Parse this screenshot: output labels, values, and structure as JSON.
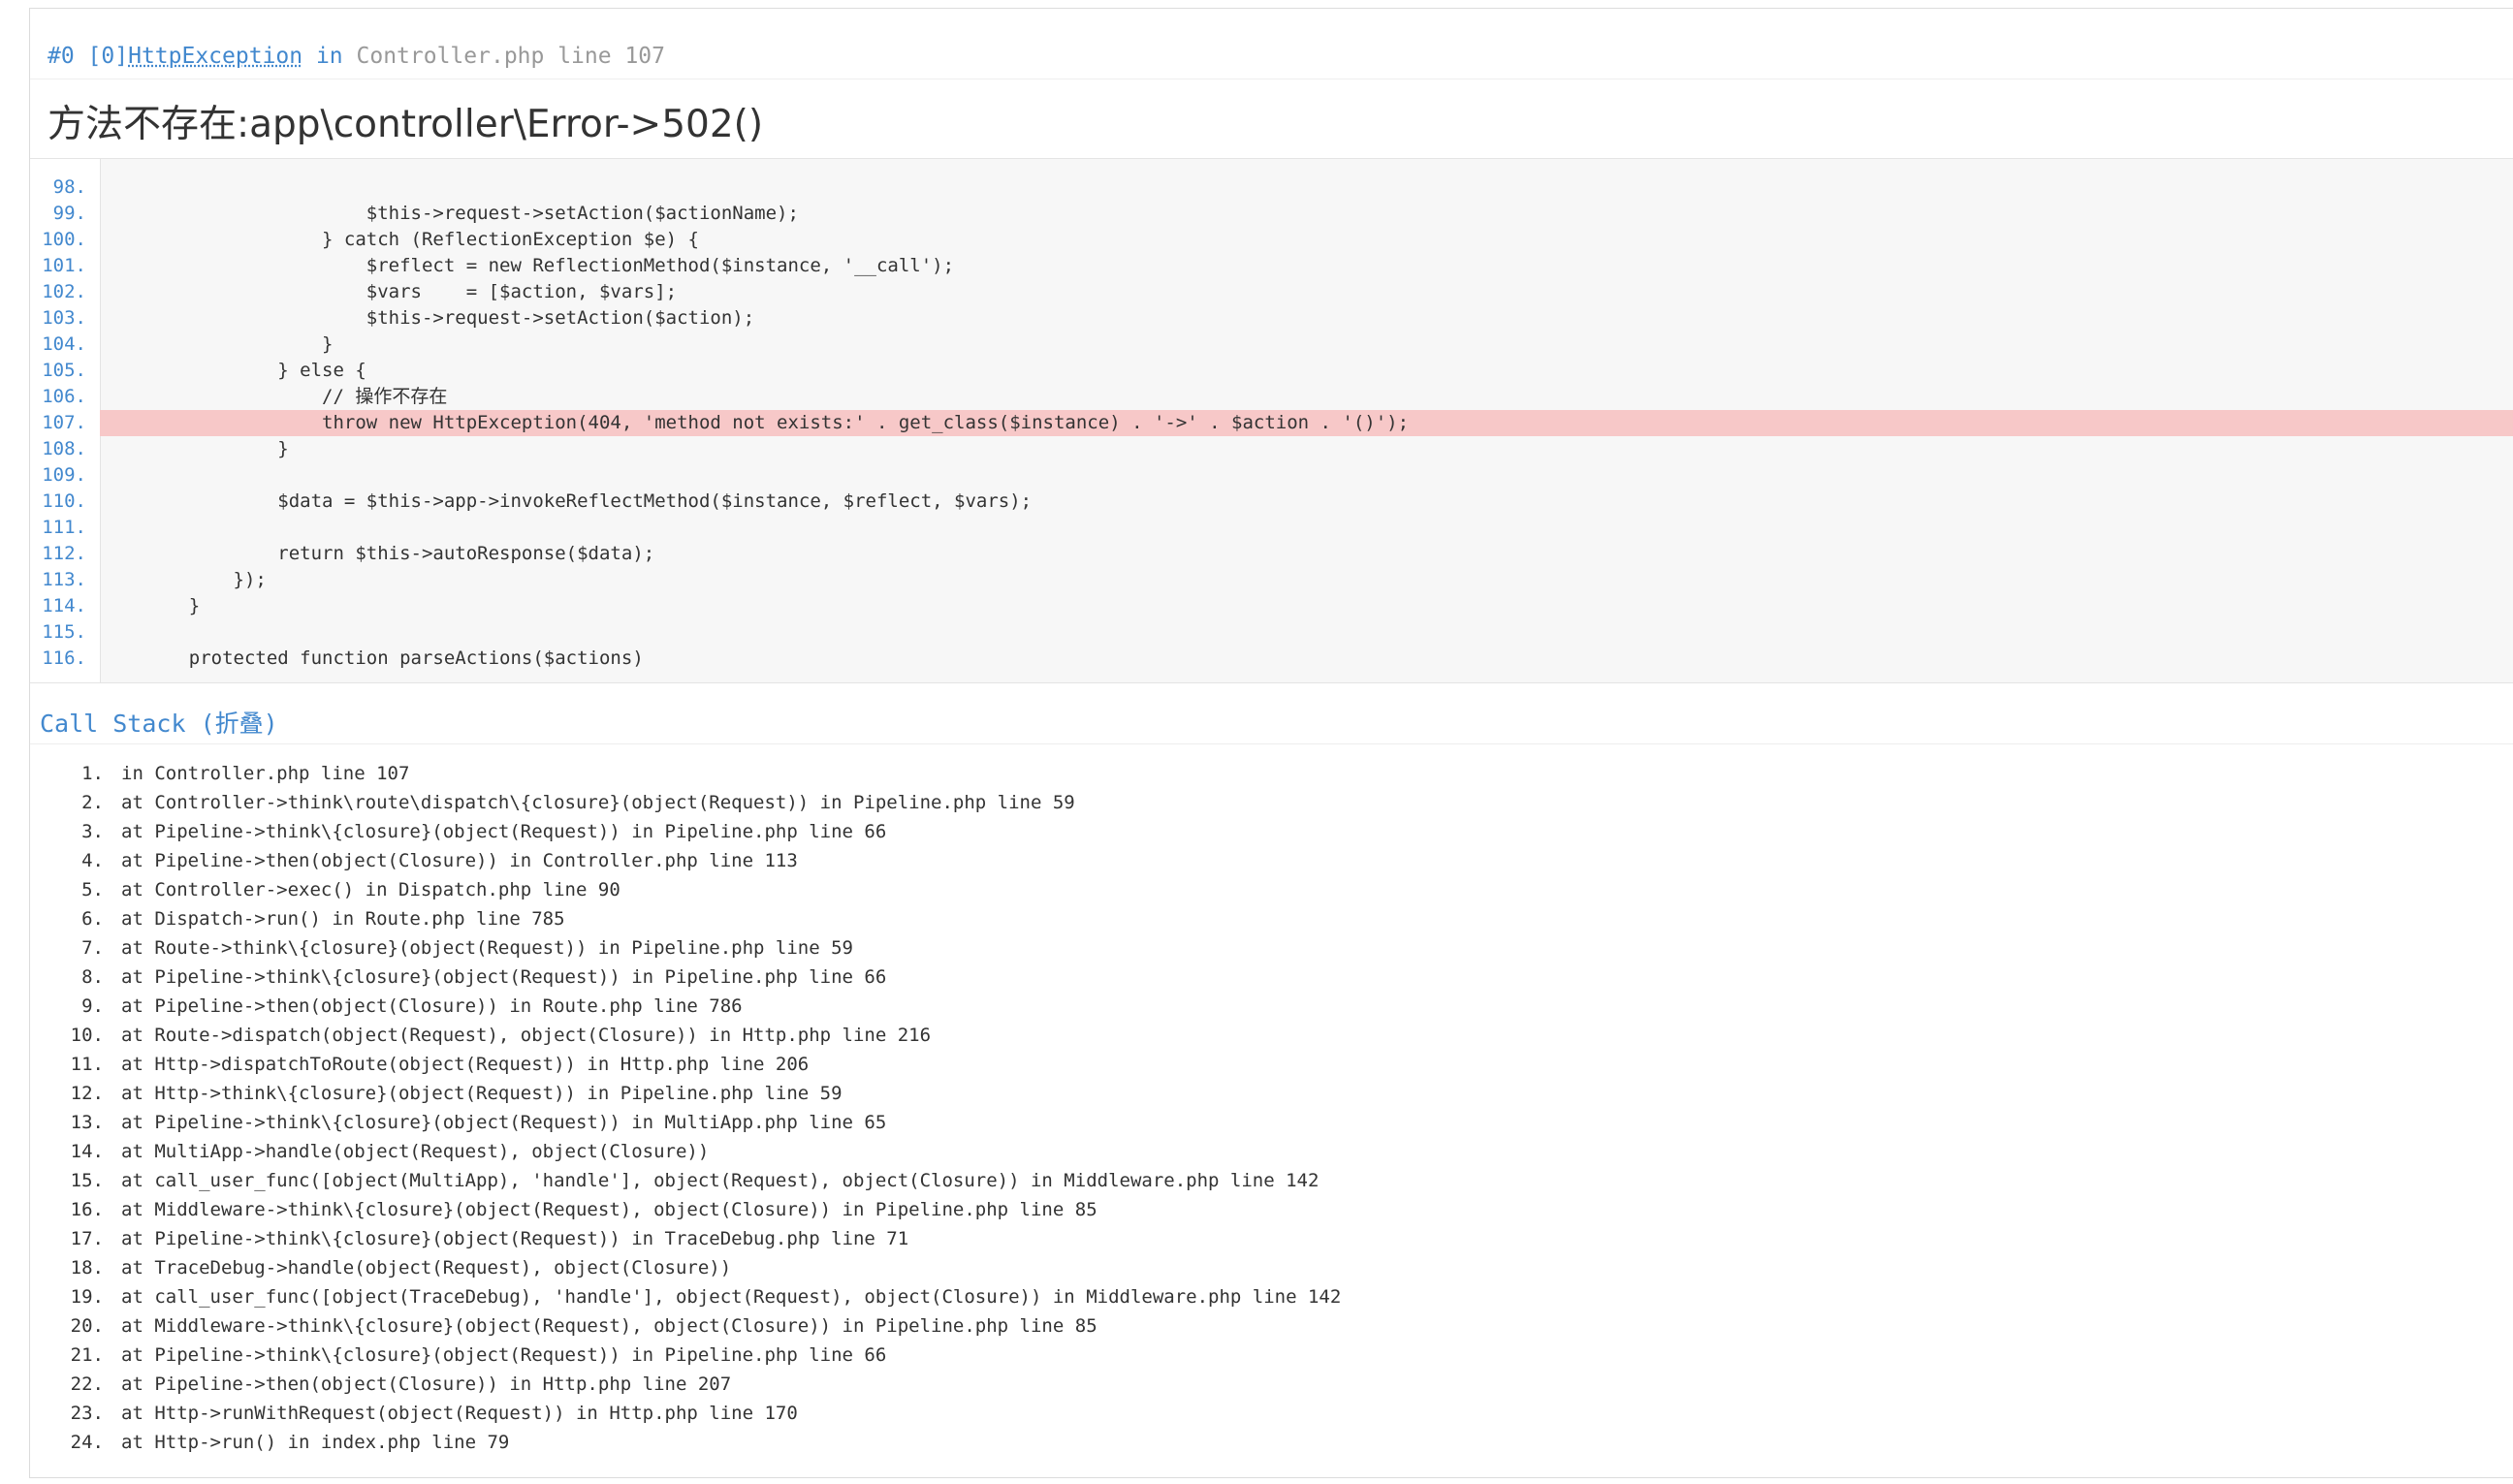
{
  "header": {
    "prefix": "#0 [0]",
    "exception_class": "HttpException",
    "in_text": " in ",
    "file": "Controller.php line 107"
  },
  "message": "方法不存在:app\\controller\\Error->502()",
  "source": {
    "highlight_line": "107.",
    "lines": [
      {
        "no": "98.",
        "code": ""
      },
      {
        "no": "99.",
        "code": "                    $this->request->setAction($actionName);"
      },
      {
        "no": "100.",
        "code": "                } catch (ReflectionException $e) {"
      },
      {
        "no": "101.",
        "code": "                    $reflect = new ReflectionMethod($instance, '__call');"
      },
      {
        "no": "102.",
        "code": "                    $vars    = [$action, $vars];"
      },
      {
        "no": "103.",
        "code": "                    $this->request->setAction($action);"
      },
      {
        "no": "104.",
        "code": "                }"
      },
      {
        "no": "105.",
        "code": "            } else {"
      },
      {
        "no": "106.",
        "code": "                // 操作不存在"
      },
      {
        "no": "107.",
        "code": "                throw new HttpException(404, 'method not exists:' . get_class($instance) . '->' . $action . '()');"
      },
      {
        "no": "108.",
        "code": "            }"
      },
      {
        "no": "109.",
        "code": ""
      },
      {
        "no": "110.",
        "code": "            $data = $this->app->invokeReflectMethod($instance, $reflect, $vars);"
      },
      {
        "no": "111.",
        "code": ""
      },
      {
        "no": "112.",
        "code": "            return $this->autoResponse($data);"
      },
      {
        "no": "113.",
        "code": "        });"
      },
      {
        "no": "114.",
        "code": "    }"
      },
      {
        "no": "115.",
        "code": ""
      },
      {
        "no": "116.",
        "code": "    protected function parseActions($actions)"
      }
    ]
  },
  "call_stack": {
    "title": "Call Stack (折叠)",
    "items": [
      {
        "n": "1.",
        "text": "in Controller.php line 107"
      },
      {
        "n": "2.",
        "text": "at Controller->think\\route\\dispatch\\{closure}(object(Request)) in Pipeline.php line 59"
      },
      {
        "n": "3.",
        "text": "at Pipeline->think\\{closure}(object(Request)) in Pipeline.php line 66"
      },
      {
        "n": "4.",
        "text": "at Pipeline->then(object(Closure)) in Controller.php line 113"
      },
      {
        "n": "5.",
        "text": "at Controller->exec() in Dispatch.php line 90"
      },
      {
        "n": "6.",
        "text": "at Dispatch->run() in Route.php line 785"
      },
      {
        "n": "7.",
        "text": "at Route->think\\{closure}(object(Request)) in Pipeline.php line 59"
      },
      {
        "n": "8.",
        "text": "at Pipeline->think\\{closure}(object(Request)) in Pipeline.php line 66"
      },
      {
        "n": "9.",
        "text": "at Pipeline->then(object(Closure)) in Route.php line 786"
      },
      {
        "n": "10.",
        "text": "at Route->dispatch(object(Request), object(Closure)) in Http.php line 216"
      },
      {
        "n": "11.",
        "text": "at Http->dispatchToRoute(object(Request)) in Http.php line 206"
      },
      {
        "n": "12.",
        "text": "at Http->think\\{closure}(object(Request)) in Pipeline.php line 59"
      },
      {
        "n": "13.",
        "text": "at Pipeline->think\\{closure}(object(Request)) in MultiApp.php line 65"
      },
      {
        "n": "14.",
        "text": "at MultiApp->handle(object(Request), object(Closure))"
      },
      {
        "n": "15.",
        "text": "at call_user_func([object(MultiApp), 'handle'], object(Request), object(Closure)) in Middleware.php line 142"
      },
      {
        "n": "16.",
        "text": "at Middleware->think\\{closure}(object(Request), object(Closure)) in Pipeline.php line 85"
      },
      {
        "n": "17.",
        "text": "at Pipeline->think\\{closure}(object(Request)) in TraceDebug.php line 71"
      },
      {
        "n": "18.",
        "text": "at TraceDebug->handle(object(Request), object(Closure))"
      },
      {
        "n": "19.",
        "text": "at call_user_func([object(TraceDebug), 'handle'], object(Request), object(Closure)) in Middleware.php line 142"
      },
      {
        "n": "20.",
        "text": "at Middleware->think\\{closure}(object(Request), object(Closure)) in Pipeline.php line 85"
      },
      {
        "n": "21.",
        "text": "at Pipeline->think\\{closure}(object(Request)) in Pipeline.php line 66"
      },
      {
        "n": "22.",
        "text": "at Pipeline->then(object(Closure)) in Http.php line 207"
      },
      {
        "n": "23.",
        "text": "at Http->runWithRequest(object(Request)) in Http.php line 170"
      },
      {
        "n": "24.",
        "text": "at Http->run() in index.php line 79"
      }
    ]
  }
}
